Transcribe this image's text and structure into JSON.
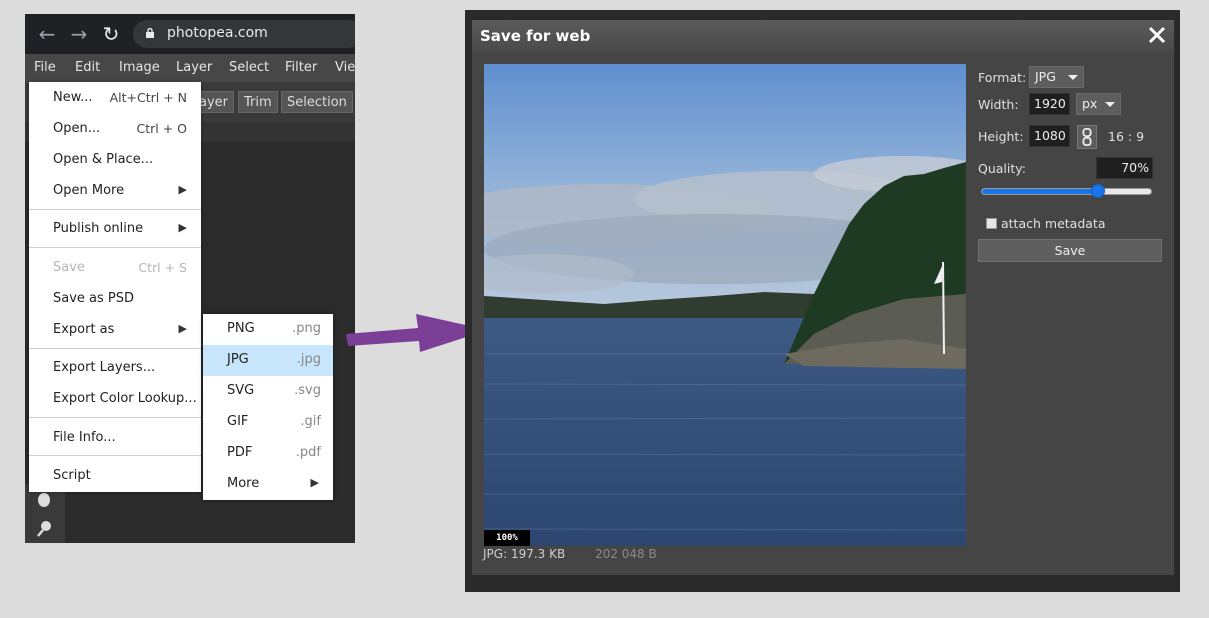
{
  "browser": {
    "url": "photopea.com"
  },
  "menubar": {
    "items": [
      "File",
      "Edit",
      "Image",
      "Layer",
      "Select",
      "Filter",
      "Vie"
    ]
  },
  "toolbar": {
    "buttons": [
      "ayer",
      "Trim",
      "Selection"
    ]
  },
  "file_menu": {
    "items": [
      {
        "label": "New...",
        "shortcut": "Alt+Ctrl + N"
      },
      {
        "label": "Open...",
        "shortcut": "Ctrl + O"
      },
      {
        "label": "Open & Place..."
      },
      {
        "label": "Open More",
        "submenu": true
      },
      {
        "label": "Publish online",
        "submenu": true
      },
      {
        "label": "Save",
        "shortcut": "Ctrl + S",
        "disabled": true
      },
      {
        "label": "Save as PSD"
      },
      {
        "label": "Export as",
        "submenu": true
      },
      {
        "label": "Export Layers..."
      },
      {
        "label": "Export Color Lookup..."
      },
      {
        "label": "File Info..."
      },
      {
        "label": "Script"
      }
    ]
  },
  "export_submenu": {
    "items": [
      {
        "label": "PNG",
        "ext": ".png"
      },
      {
        "label": "JPG",
        "ext": ".jpg",
        "highlighted": true
      },
      {
        "label": "SVG",
        "ext": ".svg"
      },
      {
        "label": "GIF",
        "ext": ".gif"
      },
      {
        "label": "PDF",
        "ext": ".pdf"
      },
      {
        "label": "More",
        "submenu": true
      }
    ]
  },
  "dialog": {
    "title": "Save for web",
    "format_label": "Format:",
    "format_value": "JPG",
    "width_label": "Width:",
    "width_value": "1920",
    "unit_value": "px",
    "height_label": "Height:",
    "height_value": "1080",
    "aspect": "16 : 9",
    "quality_label": "Quality:",
    "quality_value": "70%",
    "quality_fraction": 0.7,
    "metadata_label": "attach metadata",
    "save_label": "Save",
    "zoom": "100%",
    "file_type": "JPG:",
    "file_size": "197.3 KB",
    "file_bytes": "202 048 B"
  },
  "colors": {
    "highlight": "#c8e6fb",
    "slider": "#1a75e6",
    "arrow": "#7b3f98"
  },
  "icons": [
    "back-arrow-icon",
    "forward-arrow-icon",
    "reload-icon",
    "lock-icon",
    "submenu-arrow-icon",
    "close-icon",
    "chain-link-icon"
  ]
}
